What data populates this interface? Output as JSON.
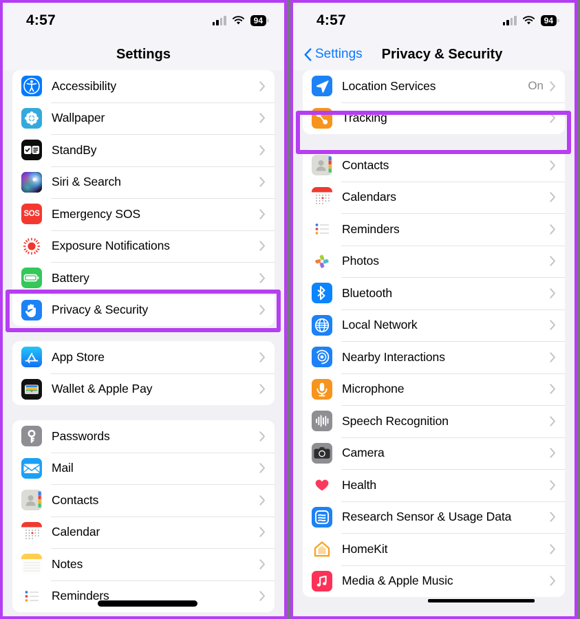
{
  "device": {
    "status_bar": {
      "time": "4:57",
      "battery": "94",
      "signal_icon": "cellular-bars-icon",
      "wifi_icon": "wifi-icon",
      "battery_icon": "battery-icon"
    },
    "accent_purple": "#b63ef2",
    "link_blue": "#0a7aff",
    "background": "#f1f0f5"
  },
  "left_screen": {
    "title": "Settings",
    "groups": [
      {
        "id": "group-main",
        "rows": [
          {
            "label": "Accessibility",
            "icon": "accessibility-icon",
            "icon_bg": "#007aff"
          },
          {
            "label": "Wallpaper",
            "icon": "wallpaper-icon",
            "icon_bg": "#34aadc"
          },
          {
            "label": "StandBy",
            "icon": "standby-icon",
            "icon_bg": "#0d0d0d"
          },
          {
            "label": "Siri & Search",
            "icon": "siri-icon",
            "icon_bg": "#1c1c2e"
          },
          {
            "label": "Emergency SOS",
            "icon": "sos-icon",
            "icon_bg": "#f5382f"
          },
          {
            "label": "Exposure Notifications",
            "icon": "exposure-notifications-icon",
            "icon_bg": "#ffffff"
          },
          {
            "label": "Battery",
            "icon": "battery-app-icon",
            "icon_bg": "#34c759"
          },
          {
            "label": "Privacy & Security",
            "icon": "privacy-hand-icon",
            "icon_bg": "#1c82f5",
            "highlighted": true
          }
        ]
      },
      {
        "id": "group-store",
        "rows": [
          {
            "label": "App Store",
            "icon": "app-store-icon",
            "icon_bg": "#1ca0f5"
          },
          {
            "label": "Wallet & Apple Pay",
            "icon": "wallet-icon",
            "icon_bg": "#121212"
          }
        ]
      },
      {
        "id": "group-apps",
        "rows": [
          {
            "label": "Passwords",
            "icon": "passwords-key-icon",
            "icon_bg": "#8e8e93"
          },
          {
            "label": "Mail",
            "icon": "mail-icon",
            "icon_bg": "#1ca0f5"
          },
          {
            "label": "Contacts",
            "icon": "contacts-icon",
            "icon_bg": "#d8d8d3"
          },
          {
            "label": "Calendar",
            "icon": "calendar-icon",
            "icon_bg": "#ffffff"
          },
          {
            "label": "Notes",
            "icon": "notes-icon",
            "icon_bg": "#ffffff"
          },
          {
            "label": "Reminders",
            "icon": "reminders-icon",
            "icon_bg": "#ffffff"
          }
        ]
      }
    ]
  },
  "right_screen": {
    "back_label": "Settings",
    "title": "Privacy & Security",
    "groups": [
      {
        "id": "group-location",
        "rows": [
          {
            "label": "Location Services",
            "value": "On",
            "icon": "location-arrow-icon",
            "icon_bg": "#1c82f5"
          },
          {
            "label": "Tracking",
            "value": "",
            "icon": "tracking-icon",
            "icon_bg": "#f7941d",
            "highlighted": true
          }
        ]
      },
      {
        "id": "group-permissions",
        "rows": [
          {
            "label": "Contacts",
            "value": "",
            "icon": "contacts-icon",
            "icon_bg": "#d8d8d3"
          },
          {
            "label": "Calendars",
            "value": "",
            "icon": "calendar-icon",
            "icon_bg": "#ffffff"
          },
          {
            "label": "Reminders",
            "value": "",
            "icon": "reminders-icon",
            "icon_bg": "#ffffff"
          },
          {
            "label": "Photos",
            "value": "",
            "icon": "photos-icon",
            "icon_bg": "#ffffff"
          },
          {
            "label": "Bluetooth",
            "value": "",
            "icon": "bluetooth-icon",
            "icon_bg": "#0a84ff"
          },
          {
            "label": "Local Network",
            "value": "",
            "icon": "local-network-globe-icon",
            "icon_bg": "#1c82f5"
          },
          {
            "label": "Nearby Interactions",
            "value": "",
            "icon": "nearby-interactions-icon",
            "icon_bg": "#1c82f5"
          },
          {
            "label": "Microphone",
            "value": "",
            "icon": "microphone-icon",
            "icon_bg": "#f7941d"
          },
          {
            "label": "Speech Recognition",
            "value": "",
            "icon": "speech-recognition-icon",
            "icon_bg": "#8e8e93"
          },
          {
            "label": "Camera",
            "value": "",
            "icon": "camera-icon",
            "icon_bg": "#8e8e93"
          },
          {
            "label": "Health",
            "value": "",
            "icon": "health-heart-icon",
            "icon_bg": "#ffffff"
          },
          {
            "label": "Research Sensor & Usage Data",
            "value": "",
            "icon": "research-sensor-icon",
            "icon_bg": "#1c82f5"
          },
          {
            "label": "HomeKit",
            "value": "",
            "icon": "homekit-icon",
            "icon_bg": "#ffffff"
          },
          {
            "label": "Media & Apple Music",
            "value": "",
            "icon": "media-apple-music-icon",
            "icon_bg": "#fc3158"
          }
        ]
      }
    ]
  }
}
